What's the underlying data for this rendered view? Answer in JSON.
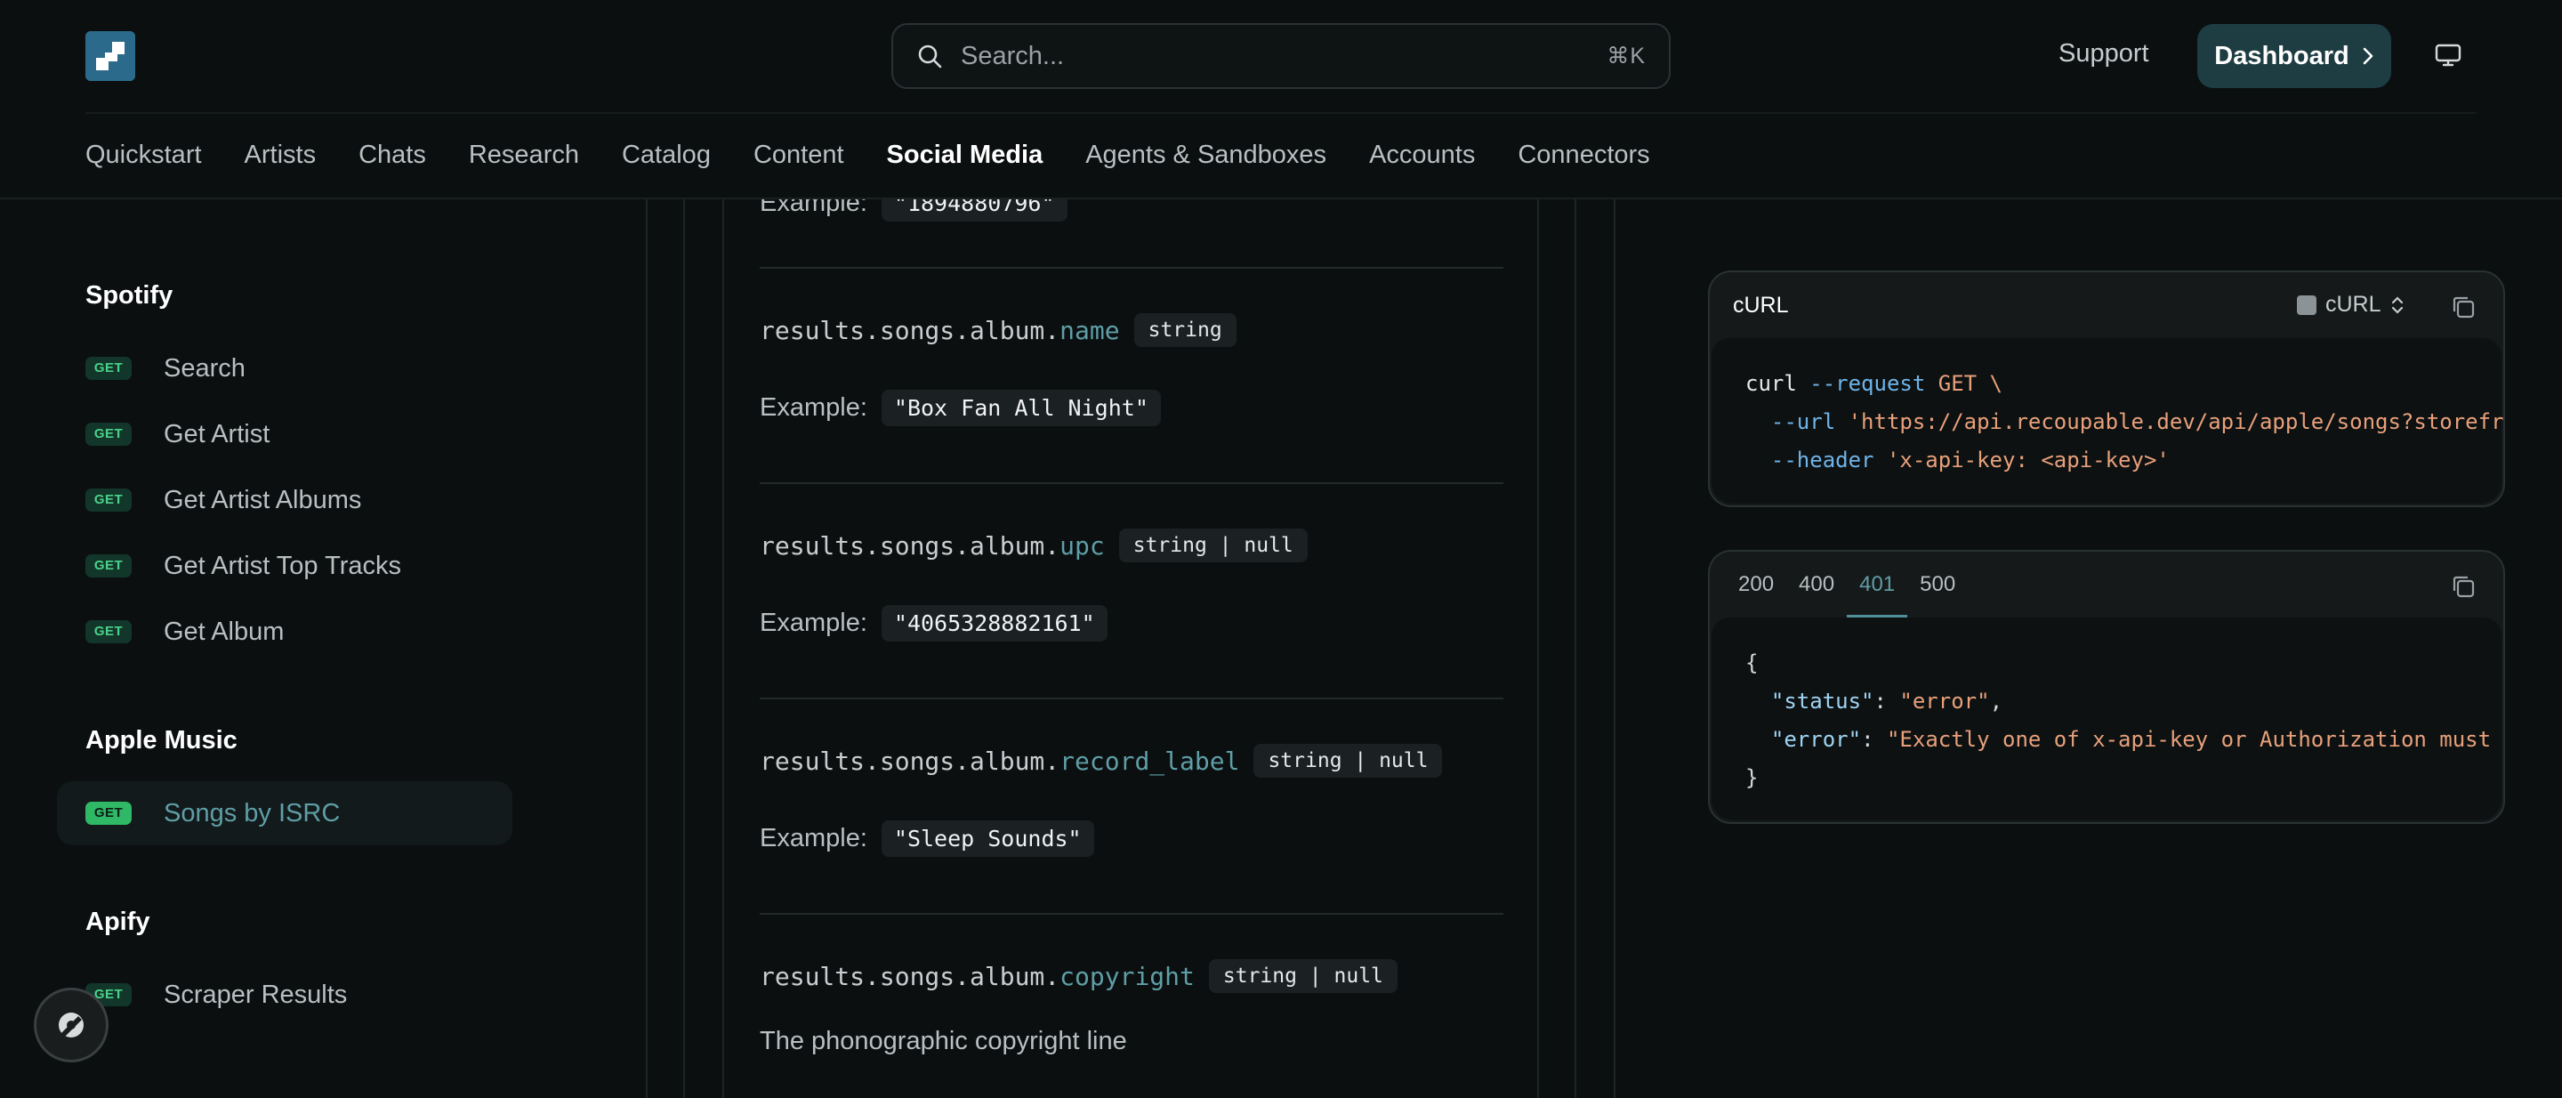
{
  "header": {
    "search_placeholder": "Search...",
    "search_shortcut": "⌘K",
    "support_label": "Support",
    "dashboard_label": "Dashboard"
  },
  "nav": [
    {
      "label": "Quickstart",
      "active": false
    },
    {
      "label": "Artists",
      "active": false
    },
    {
      "label": "Chats",
      "active": false
    },
    {
      "label": "Research",
      "active": false
    },
    {
      "label": "Catalog",
      "active": false
    },
    {
      "label": "Content",
      "active": false
    },
    {
      "label": "Social Media",
      "active": true
    },
    {
      "label": "Agents & Sandboxes",
      "active": false
    },
    {
      "label": "Accounts",
      "active": false
    },
    {
      "label": "Connectors",
      "active": false
    }
  ],
  "sidebar": {
    "sections": [
      {
        "title": "Spotify",
        "items": [
          {
            "method": "GET",
            "label": "Search"
          },
          {
            "method": "GET",
            "label": "Get Artist"
          },
          {
            "method": "GET",
            "label": "Get Artist Albums"
          },
          {
            "method": "GET",
            "label": "Get Artist Top Tracks"
          },
          {
            "method": "GET",
            "label": "Get Album"
          }
        ]
      },
      {
        "title": "Apple Music",
        "items": [
          {
            "method": "GET",
            "label": "Songs by ISRC",
            "active": true
          }
        ]
      },
      {
        "title": "Apify",
        "items": [
          {
            "method": "GET",
            "label": "Scraper Results"
          }
        ]
      }
    ]
  },
  "content": {
    "example_label": "Example:",
    "top_partial_example": "\"1894880796\"",
    "fields": [
      {
        "prefix": "results.songs.album.",
        "leaf": "name",
        "type": "string",
        "example": "\"Box Fan All Night\""
      },
      {
        "prefix": "results.songs.album.",
        "leaf": "upc",
        "type": "string | null",
        "example": "\"4065328882161\""
      },
      {
        "prefix": "results.songs.album.",
        "leaf": "record_label",
        "type": "string | null",
        "example": "\"Sleep Sounds\""
      },
      {
        "prefix": "results.songs.album.",
        "leaf": "copyright",
        "type": "string | null",
        "description": "The phonographic copyright line"
      }
    ]
  },
  "request_card": {
    "title": "cURL",
    "language": "cURL",
    "code": {
      "line1_cmd": "curl",
      "line1_flag": "--request",
      "line1_method": "GET \\",
      "line2_flag": "--url",
      "line2_url": "'https://api.recoupable.dev/api/apple/songs?storefr",
      "line3_flag": "--header",
      "line3_value": "'x-api-key: <api-key>'"
    }
  },
  "response_card": {
    "tabs": [
      {
        "label": "200",
        "active": false
      },
      {
        "label": "400",
        "active": false
      },
      {
        "label": "401",
        "active": true
      },
      {
        "label": "500",
        "active": false
      }
    ],
    "open_brace": "{",
    "close_brace": "}",
    "lines": [
      {
        "key": "\"status\"",
        "value": "\"error\"",
        "trail": ","
      },
      {
        "key": "\"error\"",
        "value": "\"Exactly one of x-api-key or Authorization must",
        "trail": ""
      }
    ]
  },
  "colors": {
    "background": "#0b0f10",
    "accent_teal": "#5f9ea6",
    "get_badge_green": "#4ad18a",
    "dashboard_button": "#1e3d43"
  },
  "icons": {
    "logo": "app-logo",
    "search": "search-icon",
    "monitor": "monitor-icon",
    "copy": "copy-icon",
    "assistant": "assistant-icon",
    "chevron": "chevron-right-icon"
  }
}
